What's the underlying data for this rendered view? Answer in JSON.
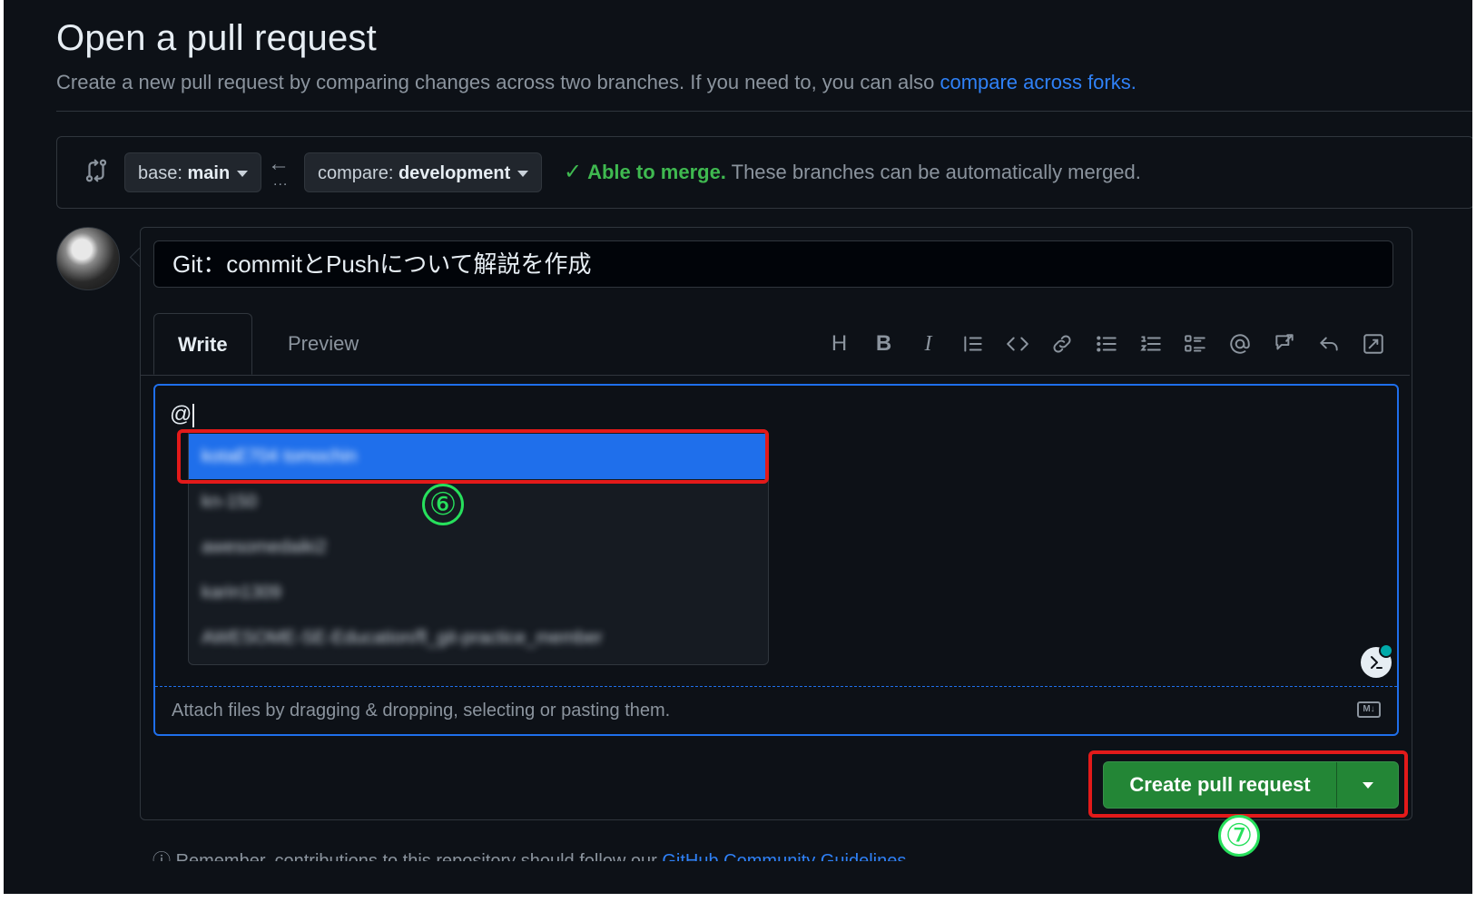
{
  "page": {
    "title": "Open a pull request",
    "subtitle": "Create a new pull request by comparing changes across two branches. If you need to, you can also ",
    "subtitle_link": "compare across forks.",
    "footer_prefix": "Remember, contributions to this repository should follow our ",
    "footer_link": "GitHub Community Guidelines"
  },
  "compare": {
    "base_label": "base:",
    "base_value": "main",
    "compare_label": "compare:",
    "compare_value": "development",
    "dots": "...",
    "merge_ok": "Able to merge.",
    "merge_text": " These branches can be automatically merged."
  },
  "form": {
    "title_value": "Git：commitとPushについて解説を作成",
    "tabs": [
      "Write",
      "Preview"
    ],
    "toolbar": [
      {
        "name": "heading-icon",
        "glyph": "H"
      },
      {
        "name": "bold-icon",
        "glyph": "B"
      },
      {
        "name": "italic-icon",
        "glyph": "I"
      },
      {
        "name": "quote-icon"
      },
      {
        "name": "code-icon"
      },
      {
        "name": "link-icon"
      },
      {
        "name": "unordered-list-icon"
      },
      {
        "name": "ordered-list-icon"
      },
      {
        "name": "task-list-icon"
      },
      {
        "name": "mention-icon"
      },
      {
        "name": "cross-reference-icon"
      },
      {
        "name": "reply-icon"
      },
      {
        "name": "fullscreen-icon"
      }
    ],
    "body_text": "@",
    "attach_text": "Attach files by dragging & dropping, selecting or pasting them.",
    "md_badge": "M↓"
  },
  "suggestions": [
    "kotaE704 tomochin",
    "kn-150",
    "awesomedaiki2",
    "karin1309",
    "AWESOME-SE-Education/fl_git-practice_member"
  ],
  "annotations": {
    "step6": "⑥",
    "step7": "⑦"
  },
  "actions": {
    "create_label": "Create pull request"
  },
  "colors": {
    "background": "#0d1117",
    "accent_blue": "#1f6feb",
    "success_green": "#3fb950",
    "button_green": "#238636",
    "annotation_red": "#e31a1a",
    "badge_green": "#27e05c"
  }
}
